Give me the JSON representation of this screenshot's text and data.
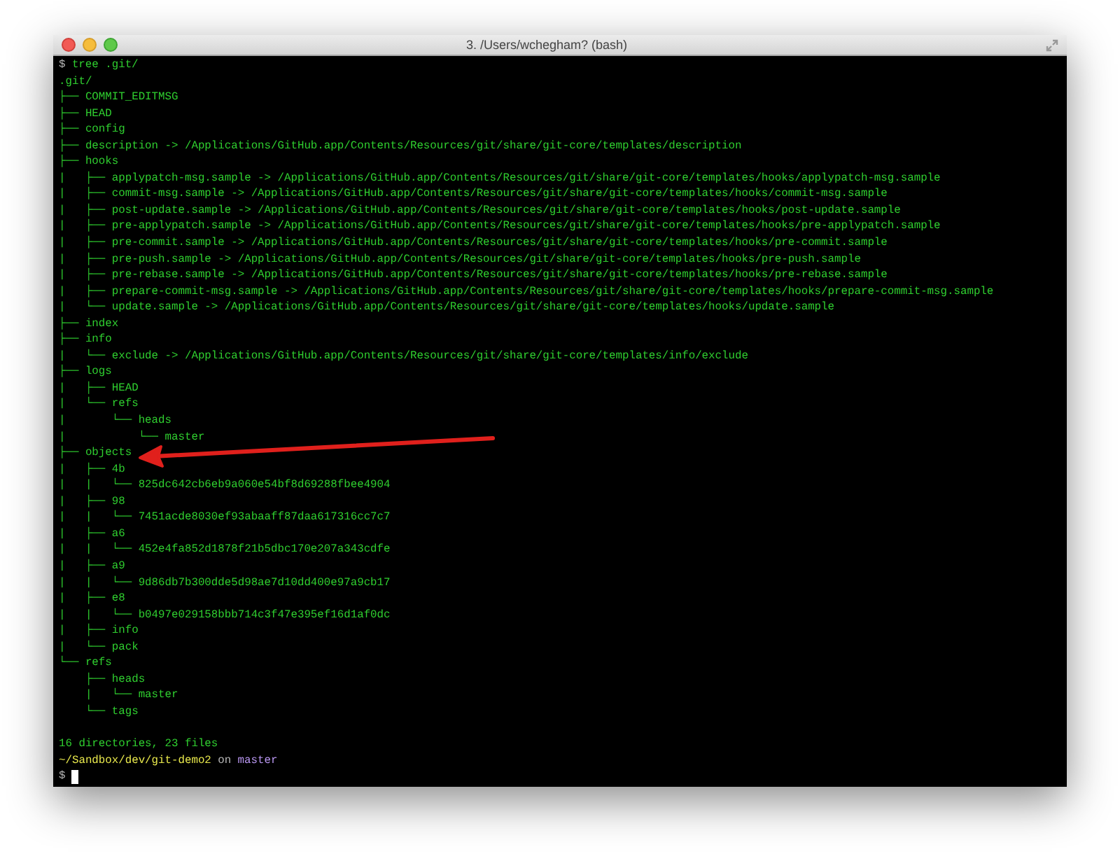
{
  "window": {
    "title": "3. /Users/wchegham? (bash)"
  },
  "command": {
    "prompt": "$",
    "text": "tree .git/"
  },
  "output": [
    ".git/",
    "├── COMMIT_EDITMSG",
    "├── HEAD",
    "├── config",
    "├── description -> /Applications/GitHub.app/Contents/Resources/git/share/git-core/templates/description",
    "├── hooks",
    "|   ├── applypatch-msg.sample -> /Applications/GitHub.app/Contents/Resources/git/share/git-core/templates/hooks/applypatch-msg.sample",
    "|   ├── commit-msg.sample -> /Applications/GitHub.app/Contents/Resources/git/share/git-core/templates/hooks/commit-msg.sample",
    "|   ├── post-update.sample -> /Applications/GitHub.app/Contents/Resources/git/share/git-core/templates/hooks/post-update.sample",
    "|   ├── pre-applypatch.sample -> /Applications/GitHub.app/Contents/Resources/git/share/git-core/templates/hooks/pre-applypatch.sample",
    "|   ├── pre-commit.sample -> /Applications/GitHub.app/Contents/Resources/git/share/git-core/templates/hooks/pre-commit.sample",
    "|   ├── pre-push.sample -> /Applications/GitHub.app/Contents/Resources/git/share/git-core/templates/hooks/pre-push.sample",
    "|   ├── pre-rebase.sample -> /Applications/GitHub.app/Contents/Resources/git/share/git-core/templates/hooks/pre-rebase.sample",
    "|   ├── prepare-commit-msg.sample -> /Applications/GitHub.app/Contents/Resources/git/share/git-core/templates/hooks/prepare-commit-msg.sample",
    "|   └── update.sample -> /Applications/GitHub.app/Contents/Resources/git/share/git-core/templates/hooks/update.sample",
    "├── index",
    "├── info",
    "|   └── exclude -> /Applications/GitHub.app/Contents/Resources/git/share/git-core/templates/info/exclude",
    "├── logs",
    "|   ├── HEAD",
    "|   └── refs",
    "|       └── heads",
    "|           └── master",
    "├── objects",
    "|   ├── 4b",
    "|   |   └── 825dc642cb6eb9a060e54bf8d69288fbee4904",
    "|   ├── 98",
    "|   |   └── 7451acde8030ef93abaaff87daa617316cc7c7",
    "|   ├── a6",
    "|   |   └── 452e4fa852d1878f21b5dbc170e207a343cdfe",
    "|   ├── a9",
    "|   |   └── 9d86db7b300dde5d98ae7d10dd400e97a9cb17",
    "|   ├── e8",
    "|   |   └── b0497e029158bbb714c3f47e395ef16d1af0dc",
    "|   ├── info",
    "|   └── pack",
    "└── refs",
    "    ├── heads",
    "    |   └── master",
    "    └── tags"
  ],
  "summary": "16 directories, 23 files",
  "status": {
    "path": "~/Sandbox/dev/git-demo2",
    "joiner": "on",
    "branch": "master"
  },
  "input": {
    "prompt": "$"
  }
}
